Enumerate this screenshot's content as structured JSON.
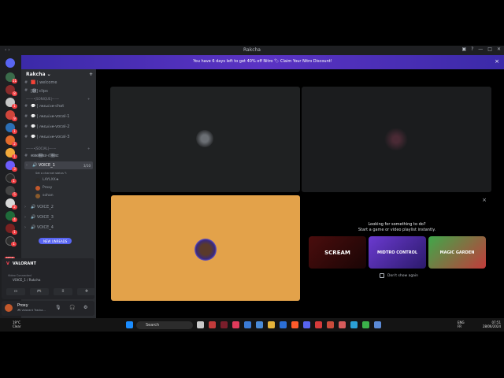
{
  "window": {
    "title": "Rakcha"
  },
  "banner": {
    "message": "You have 6 days left to get 40% off Nitro   🏷 Claim Your Nitro Discount!",
    "close": "×"
  },
  "server": {
    "name": "Rakcha",
    "chevron": "⌄",
    "add": "+"
  },
  "channels": {
    "rows": [
      {
        "icon": "#",
        "label": "🟥 | welcome",
        "top": 0
      },
      {
        "icon": "#",
        "label": "[🅴] clips"
      },
      {
        "icon": "#",
        "label": "💬 | 𝘳𝘦𝘴𝘶𝘪𝘷𝘦-chat"
      },
      {
        "icon": "#",
        "label": "💬 | 𝘳𝘦𝘴𝘶𝘪𝘷𝘦-vocal-1"
      },
      {
        "icon": "#",
        "label": "💬 | 𝘳𝘦𝘴𝘶𝘪𝘷𝘦-vocal-2"
      },
      {
        "icon": "#",
        "label": "💬 | 𝘳𝘦𝘴𝘶𝘪𝘷𝘦-vocal-3"
      }
    ],
    "cat1": "—·—•|SONIQUE|—·—",
    "cat2": "—·—•|SOCIAL|—·—",
    "general": "𝔊𝔈𝔑𝔈𝔕𝔄𝔏-ℭ𝔋𝔄𝔗",
    "voice1": {
      "label": "🔊 VOICE_1",
      "count": "3/10",
      "note": "Set a channel status ✎"
    },
    "voice_users": [
      "LAYLXX★",
      "Proxy",
      "sohan"
    ],
    "voice_others": [
      "🔊 VOICE_2",
      "🔊 VOICE_3",
      "🔊 VOICE_4"
    ],
    "new_unreads": "NEW UNREADS"
  },
  "voice_panel": {
    "game": "VALORANT",
    "sub": "Video Connected",
    "location": "VOICE_1 / Rakcha",
    "buttons": [
      "▭",
      "🎮",
      "⁞⁞",
      "✈"
    ]
  },
  "user": {
    "name": "Proxy",
    "status": "🎮 Valorant Tracka...",
    "icons": [
      "🎙",
      "🎧",
      "⚙"
    ]
  },
  "activity": {
    "close": "×",
    "line1": "Looking for something to do?",
    "line2": "Start a game or video playlist instantly.",
    "cards": [
      "SCREAM",
      "MIDTRO CONTROL",
      "MAGIC GARDEN"
    ],
    "checkbox": "Don't show again"
  },
  "taskbar": {
    "weather_temp": "19°C",
    "weather_desc": "Clear",
    "search": "Search",
    "lang1": "ENG",
    "lang2": "FR",
    "time": "07:51",
    "date": "28/06/2024"
  },
  "colors": {
    "rail_bg": "#1e1f22",
    "channel_bg": "#2b2d31",
    "banner": "#5b33c4",
    "tile3": "#e3a24a",
    "unread": "#f23f43"
  }
}
